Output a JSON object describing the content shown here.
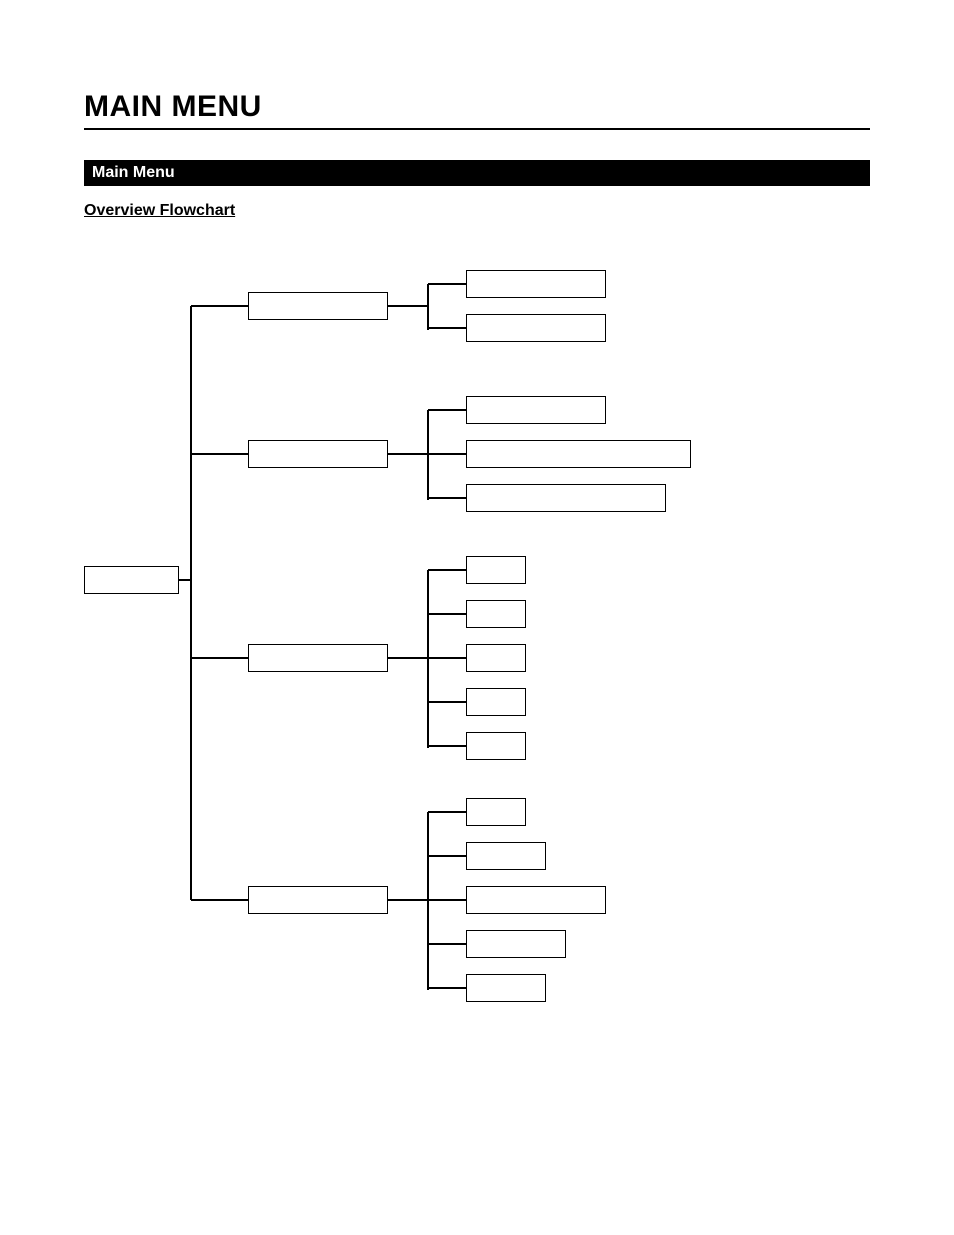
{
  "page": {
    "title": "MAIN MENU",
    "section_bar": "Main Menu",
    "flowchart_label": "Overview Flowchart"
  },
  "chart_data": {
    "type": "tree",
    "root": {
      "id": "root",
      "label": ""
    },
    "branches": [
      {
        "id": "b1",
        "label": "",
        "children": [
          {
            "id": "b1c1",
            "label": ""
          },
          {
            "id": "b1c2",
            "label": ""
          }
        ]
      },
      {
        "id": "b2",
        "label": "",
        "children": [
          {
            "id": "b2c1",
            "label": ""
          },
          {
            "id": "b2c2",
            "label": ""
          },
          {
            "id": "b2c3",
            "label": ""
          }
        ]
      },
      {
        "id": "b3",
        "label": "",
        "children": [
          {
            "id": "b3c1",
            "label": ""
          },
          {
            "id": "b3c2",
            "label": ""
          },
          {
            "id": "b3c3",
            "label": ""
          },
          {
            "id": "b3c4",
            "label": ""
          },
          {
            "id": "b3c5",
            "label": ""
          }
        ]
      },
      {
        "id": "b4",
        "label": "",
        "children": [
          {
            "id": "b4c1",
            "label": ""
          },
          {
            "id": "b4c2",
            "label": ""
          },
          {
            "id": "b4c3",
            "label": ""
          },
          {
            "id": "b4c4",
            "label": ""
          },
          {
            "id": "b4c5",
            "label": ""
          }
        ]
      }
    ]
  }
}
